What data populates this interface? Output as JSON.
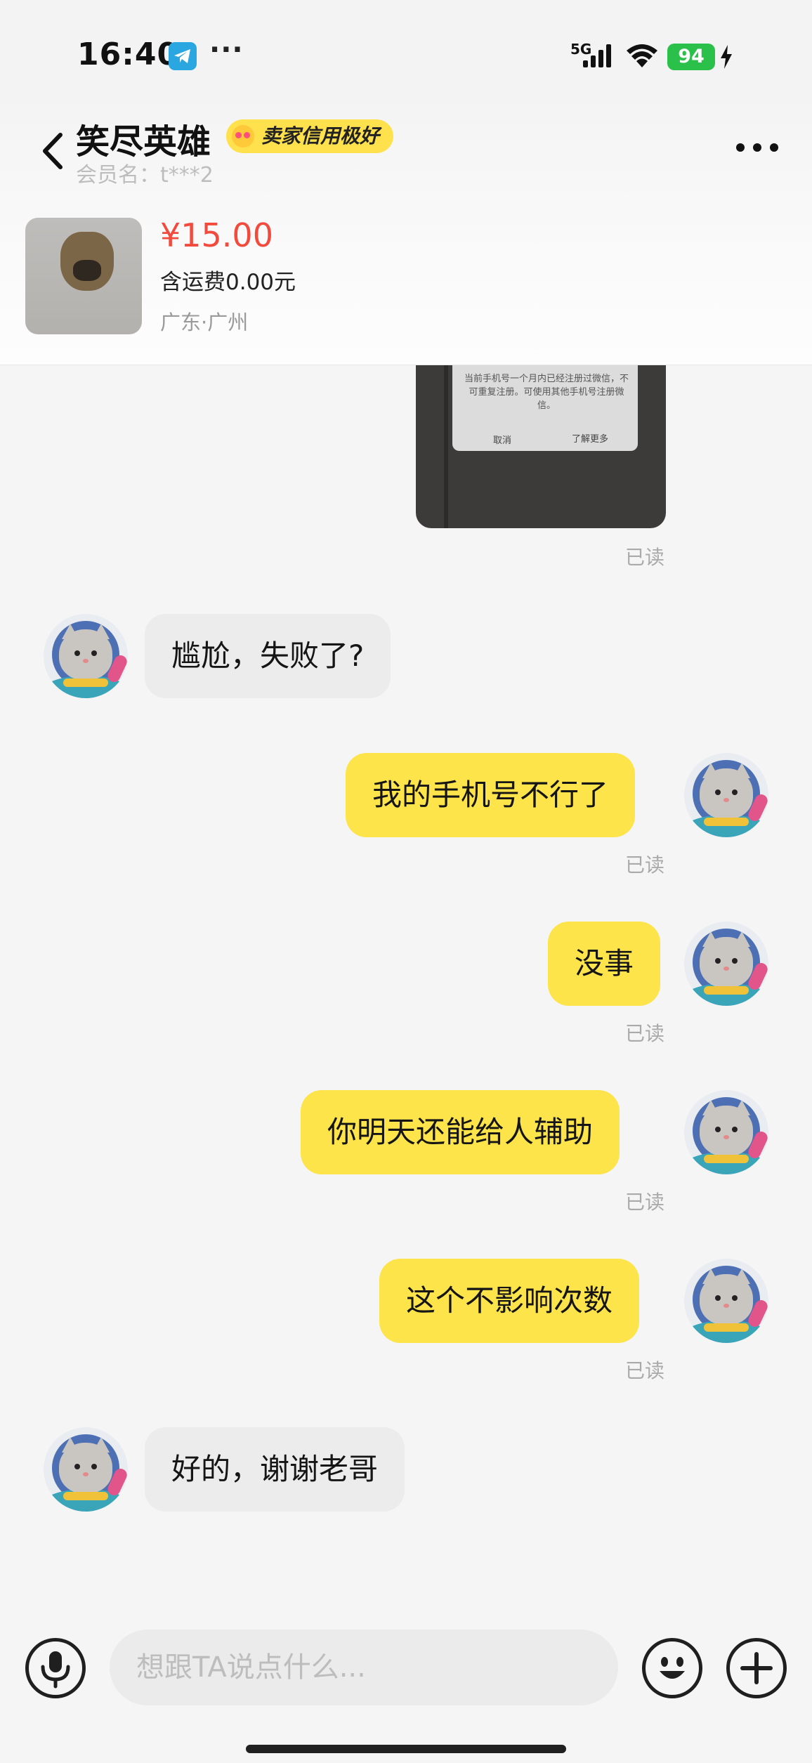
{
  "status_bar": {
    "time": "16:40",
    "overflow_dots": "···",
    "network": "5G",
    "battery": "94",
    "colors": {
      "battery": "#2bc04a",
      "telegram": "#2aa6e0"
    }
  },
  "header": {
    "seller_name": "笑尽英雄",
    "credit_badge": "卖家信用极好",
    "member_label": "会员名：t***2"
  },
  "product": {
    "price": "¥15.00",
    "shipping": "含运费0.00元",
    "location": "广东·广州"
  },
  "shared_image": {
    "dialog_text": "当前手机号一个月内已经注册过微信，不可重复注册。可使用其他手机号注册微信。",
    "cancel": "取消",
    "learn_more": "了解更多"
  },
  "messages": [
    {
      "side": "right",
      "type": "image",
      "read": "已读"
    },
    {
      "side": "left",
      "text": "尴尬，失败了?"
    },
    {
      "side": "right",
      "text": "我的手机号不行了",
      "read": "已读"
    },
    {
      "side": "right",
      "text": "没事",
      "read": "已读"
    },
    {
      "side": "right",
      "text": "你明天还能给人辅助",
      "read": "已读"
    },
    {
      "side": "right",
      "text": "这个不影响次数",
      "read": "已读"
    },
    {
      "side": "left",
      "text": "好的，谢谢老哥"
    }
  ],
  "input": {
    "placeholder": "想跟TA说点什么..."
  },
  "icons": [
    "back-icon",
    "more-icon",
    "mic-icon",
    "emoji-icon",
    "plus-icon",
    "telegram-icon",
    "signal-icon",
    "wifi-icon",
    "bolt-icon"
  ],
  "theme": {
    "accent_yellow": "#fde44a",
    "price_red": "#f24a3c",
    "left_bubble": "#ececec"
  }
}
